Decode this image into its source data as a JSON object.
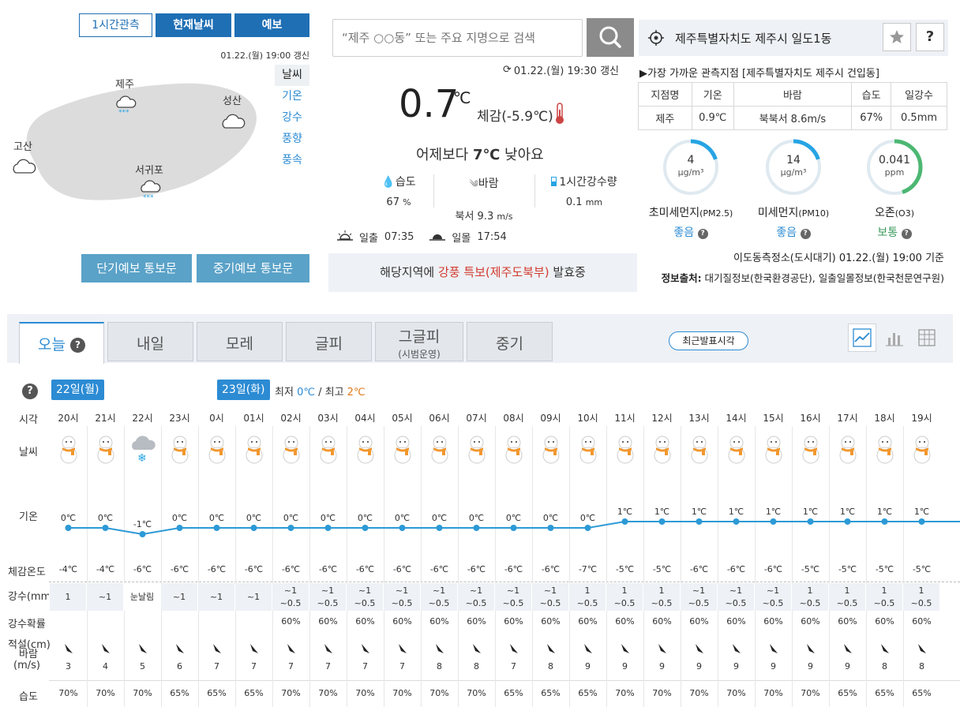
{
  "map_panel": {
    "tabs": [
      "1시간관측",
      "현재날씨",
      "예보"
    ],
    "updated": "01.22.(월) 19:00 갱신",
    "side_tabs": [
      "날씨",
      "기온",
      "강수",
      "풍향",
      "풍속"
    ],
    "places": [
      {
        "name": "제주",
        "icon": "snow-cloud-icon"
      },
      {
        "name": "성산",
        "icon": "cloud-icon"
      },
      {
        "name": "고산",
        "icon": "cloud-icon"
      },
      {
        "name": "서귀포",
        "icon": "snow-cloud-icon"
      }
    ],
    "buttons": [
      "단기예보 통보문",
      "중기예보 통보문"
    ]
  },
  "current": {
    "search_placeholder": "“제주 ○○동” 또는 주요 지명으로 검색",
    "updated": "01.22.(월) 19:30 갱신",
    "temp": "0.7",
    "temp_unit": "℃",
    "feels": "체감(-5.9℃)",
    "compare_pre": "어제보다 ",
    "compare_val": "7℃",
    "compare_post": " 낮아요",
    "stats": [
      {
        "label": "습도",
        "value": "67",
        "unit": "%"
      },
      {
        "label": "바람",
        "value": "북서 9.3",
        "unit": "m/s"
      },
      {
        "label": "1시간강수량",
        "value": "0.1",
        "unit": "mm"
      }
    ],
    "sunrise_label": "일출",
    "sunrise": "07:35",
    "sunset_label": "일몰",
    "sunset": "17:54",
    "alert_pre": "해당지역에 ",
    "alert_hl1": "강풍 특보",
    "alert_hl2": "(제주도북부)",
    "alert_post": " 발효중"
  },
  "location": {
    "name": "제주특별자치도 제주시 일도1동",
    "nearest": "▶가장 가까운 관측지점 [제주특별자치도 제주시 건입동]",
    "obs_headers": [
      "지점명",
      "기온",
      "바람",
      "습도",
      "일강수"
    ],
    "obs_values": [
      "제주",
      "0.9℃",
      "북북서 8.6m/s",
      "67%",
      "0.5mm"
    ],
    "air": [
      {
        "value": "4",
        "unit": "μg/m³",
        "label": "초미세먼지",
        "sub": "(PM2.5)",
        "grade": "좋음",
        "color": "#27a4e3",
        "fraction": 0.2
      },
      {
        "value": "14",
        "unit": "μg/m³",
        "label": "미세먼지",
        "sub": "(PM10)",
        "grade": "좋음",
        "color": "#27a4e3",
        "fraction": 0.2
      },
      {
        "value": "0.041",
        "unit": "ppm",
        "label": "오존",
        "sub": "(O3)",
        "grade": "보통",
        "color": "#4cb772",
        "fraction": 0.45
      }
    ],
    "air_source": "이도동측정소(도시대기) 01.22.(월) 19:00 기준",
    "info_source_label": "정보출처:",
    "info_source": " 대기질정보(한국환경공단), 일출일몰정보(한국천문연구원)"
  },
  "forecast": {
    "tabs": [
      {
        "label": "오늘",
        "sub": ""
      },
      {
        "label": "내일",
        "sub": ""
      },
      {
        "label": "모레",
        "sub": ""
      },
      {
        "label": "글피",
        "sub": ""
      },
      {
        "label": "그글피",
        "sub": "(시범운영)"
      },
      {
        "label": "중기",
        "sub": ""
      }
    ],
    "latest_btn": "최근발표시각",
    "day1": "22일(월)",
    "day2": "23일(화)",
    "minmax_min_label": "최저",
    "minmax_min": "0℃",
    "minmax_sep": "/",
    "minmax_max_label": "최고",
    "minmax_max": "2℃",
    "row_labels": {
      "time": "시각",
      "weather": "날씨",
      "temp": "기온",
      "feels": "체감온도",
      "precip": "강수(mm)",
      "prob": "강수확률",
      "snow": "적설(cm)",
      "wind": "바람",
      "wind_unit": "(m/s)",
      "humidity": "습도"
    },
    "hours": [
      "20시",
      "21시",
      "22시",
      "23시",
      "0시",
      "01시",
      "02시",
      "03시",
      "04시",
      "05시",
      "06시",
      "07시",
      "08시",
      "09시",
      "10시",
      "11시",
      "12시",
      "13시",
      "14시",
      "15시",
      "16시",
      "17시",
      "18시",
      "19시"
    ],
    "weather_icons": [
      "snowman-icon",
      "snowman-icon",
      "snow-cloud-icon",
      "snowman-icon",
      "snowman-icon",
      "snowman-icon",
      "snowman-icon",
      "snowman-icon",
      "snowman-icon",
      "snowman-icon",
      "snowman-icon",
      "snowman-icon",
      "snowman-icon",
      "snowman-icon",
      "snowman-icon",
      "snowman-icon",
      "snowman-icon",
      "snowman-icon",
      "snowman-icon",
      "snowman-icon",
      "snowman-icon",
      "snowman-icon",
      "snowman-icon",
      "snowman-icon"
    ],
    "temps": [
      0,
      0,
      -1,
      0,
      0,
      0,
      0,
      0,
      0,
      0,
      0,
      0,
      0,
      0,
      0,
      1,
      1,
      1,
      1,
      1,
      1,
      1,
      1,
      1
    ],
    "temp_labels": [
      "0℃",
      "0℃",
      "-1℃",
      "0℃",
      "0℃",
      "0℃",
      "0℃",
      "0℃",
      "0℃",
      "0℃",
      "0℃",
      "0℃",
      "0℃",
      "0℃",
      "0℃",
      "1℃",
      "1℃",
      "1℃",
      "1℃",
      "1℃",
      "1℃",
      "1℃",
      "1℃",
      "1℃"
    ],
    "feels": [
      "-4℃",
      "-4℃",
      "-6℃",
      "-6℃",
      "-6℃",
      "-6℃",
      "-6℃",
      "-6℃",
      "-6℃",
      "-6℃",
      "-6℃",
      "-6℃",
      "-6℃",
      "-6℃",
      "-7℃",
      "-5℃",
      "-5℃",
      "-6℃",
      "-6℃",
      "-6℃",
      "-5℃",
      "-5℃",
      "-5℃",
      "-5℃"
    ],
    "precip": [
      "1",
      "~1",
      "눈날림",
      "~1",
      "~1",
      "~1",
      "~1",
      "~1",
      "~1",
      "~1",
      "~1",
      "~1",
      "~1",
      "~1",
      "1",
      "1",
      "1",
      "~1",
      "~1",
      "~1",
      "1",
      "1",
      "1",
      "1"
    ],
    "snow": [
      "",
      "",
      "",
      "",
      "",
      "",
      "~0.5",
      "~0.5",
      "~0.5",
      "~0.5",
      "~0.5",
      "~0.5",
      "~0.5",
      "~0.5",
      "~0.5",
      "~0.5",
      "~0.5",
      "~0.5",
      "~0.5",
      "~0.5",
      "~0.5",
      "~0.5",
      "~0.5",
      "~0.5"
    ],
    "prob": [
      "",
      "",
      "",
      "",
      "",
      "",
      "60%",
      "60%",
      "60%",
      "60%",
      "60%",
      "60%",
      "60%",
      "60%",
      "60%",
      "60%",
      "60%",
      "60%",
      "60%",
      "60%",
      "60%",
      "60%",
      "60%",
      "60%"
    ],
    "wind": [
      "3",
      "4",
      "5",
      "6",
      "7",
      "7",
      "7",
      "7",
      "7",
      "7",
      "8",
      "8",
      "7",
      "8",
      "9",
      "9",
      "9",
      "9",
      "9",
      "9",
      "9",
      "9",
      "8",
      "8"
    ],
    "humidity": [
      "70%",
      "70%",
      "70%",
      "65%",
      "65%",
      "65%",
      "70%",
      "70%",
      "70%",
      "70%",
      "70%",
      "70%",
      "65%",
      "65%",
      "65%",
      "70%",
      "70%",
      "70%",
      "70%",
      "70%",
      "70%",
      "65%",
      "65%",
      "65%"
    ]
  }
}
